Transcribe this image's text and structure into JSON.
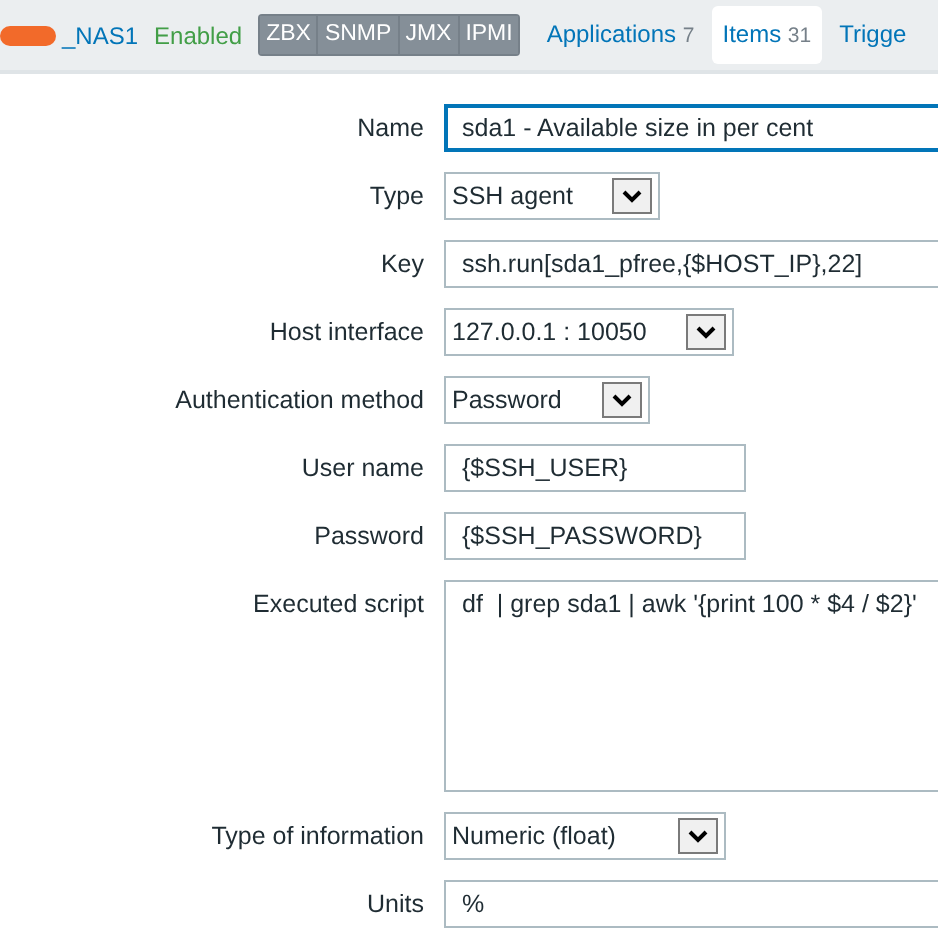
{
  "header": {
    "host": "_NAS1",
    "status": "Enabled",
    "interfaces": [
      "ZBX",
      "SNMP",
      "JMX",
      "IPMI"
    ],
    "tabs": [
      {
        "label": "Applications",
        "count": "7",
        "selected": false
      },
      {
        "label": "Items",
        "count": "31",
        "selected": true
      },
      {
        "label": "Trigge",
        "selected": false
      }
    ]
  },
  "form": {
    "fields": [
      {
        "label": "Name",
        "kind": "text",
        "value": "sda1 - Available size in per cent",
        "focused": true
      },
      {
        "label": "Type",
        "kind": "select",
        "value": "SSH agent",
        "focused": false
      },
      {
        "label": "Key",
        "kind": "text",
        "value": "ssh.run[sda1_pfree,{$HOST_IP},22]",
        "focused": false
      },
      {
        "label": "Host interface",
        "kind": "select",
        "value": "127.0.0.1 : 10050",
        "focused": false
      },
      {
        "label": "Authentication method",
        "kind": "select",
        "value": "Password",
        "focused": false
      },
      {
        "label": "User name",
        "kind": "short",
        "value": "{$SSH_USER}",
        "focused": false
      },
      {
        "label": "Password",
        "kind": "short",
        "value": "{$SSH_PASSWORD}",
        "focused": false
      },
      {
        "label": "Executed script",
        "kind": "textarea",
        "value": "df  | grep sda1 | awk '{print 100 * $4 / $2}'",
        "focused": false
      },
      {
        "label": "Type of information",
        "kind": "select",
        "value": "Numeric (float)",
        "focused": false
      },
      {
        "label": "Units",
        "kind": "text",
        "value": "%",
        "focused": false
      }
    ]
  }
}
